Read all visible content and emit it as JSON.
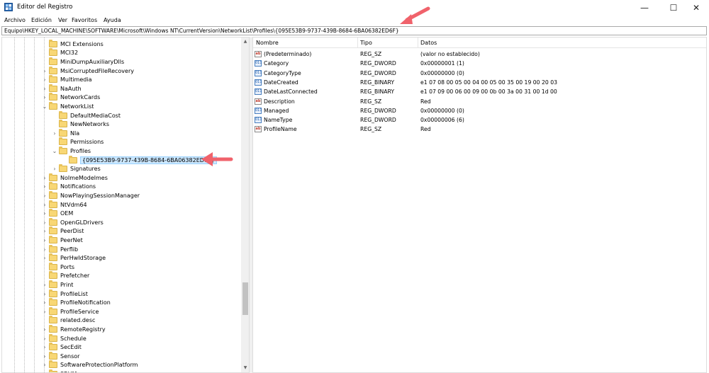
{
  "window": {
    "title": "Editor del Registro",
    "min_glyph": "—",
    "max_glyph": "☐",
    "close_glyph": "✕"
  },
  "menu": [
    "Archivo",
    "Edición",
    "Ver",
    "Favoritos",
    "Ayuda"
  ],
  "address": "Equipo\\HKEY_LOCAL_MACHINE\\SOFTWARE\\Microsoft\\Windows NT\\CurrentVersion\\NetworkList\\Profiles\\{095E53B9-9737-439B-8684-6BA06382ED6F}",
  "tree": [
    {
      "label": "MCI Extensions",
      "expandable": false
    },
    {
      "label": "MCI32",
      "expandable": false
    },
    {
      "label": "MiniDumpAuxiliaryDlls",
      "expandable": false
    },
    {
      "label": "MsiCorruptedFileRecovery",
      "expandable": true
    },
    {
      "label": "Multimedia",
      "expandable": true
    },
    {
      "label": "NaAuth",
      "expandable": true
    },
    {
      "label": "NetworkCards",
      "expandable": true
    },
    {
      "label": "NetworkList",
      "expandable": true,
      "expanded": true
    },
    {
      "label": "DefaultMediaCost",
      "expandable": false,
      "level": 1
    },
    {
      "label": "NewNetworks",
      "expandable": false,
      "level": 1
    },
    {
      "label": "Nla",
      "expandable": true,
      "level": 1
    },
    {
      "label": "Permissions",
      "expandable": false,
      "level": 1
    },
    {
      "label": "Profiles",
      "expandable": true,
      "expanded": true,
      "level": 1
    },
    {
      "label": "{095E53B9-9737-439B-8684-6BA06382ED6F}",
      "expandable": false,
      "level": 2,
      "selected": true
    },
    {
      "label": "Signatures",
      "expandable": true,
      "level": 1
    },
    {
      "label": "NoImeModelmes",
      "expandable": true
    },
    {
      "label": "Notifications",
      "expandable": true
    },
    {
      "label": "NowPlayingSessionManager",
      "expandable": true
    },
    {
      "label": "NtVdm64",
      "expandable": true
    },
    {
      "label": "OEM",
      "expandable": true
    },
    {
      "label": "OpenGLDrivers",
      "expandable": true
    },
    {
      "label": "PeerDist",
      "expandable": true
    },
    {
      "label": "PeerNet",
      "expandable": true
    },
    {
      "label": "Perflib",
      "expandable": true
    },
    {
      "label": "PerHwIdStorage",
      "expandable": true
    },
    {
      "label": "Ports",
      "expandable": false
    },
    {
      "label": "Prefetcher",
      "expandable": false
    },
    {
      "label": "Print",
      "expandable": true
    },
    {
      "label": "ProfileList",
      "expandable": true
    },
    {
      "label": "ProfileNotification",
      "expandable": true
    },
    {
      "label": "ProfileService",
      "expandable": true
    },
    {
      "label": "related.desc",
      "expandable": false
    },
    {
      "label": "RemoteRegistry",
      "expandable": true
    },
    {
      "label": "Schedule",
      "expandable": true
    },
    {
      "label": "SecEdit",
      "expandable": true
    },
    {
      "label": "Sensor",
      "expandable": true
    },
    {
      "label": "SoftwareProtectionPlatform",
      "expandable": true
    },
    {
      "label": "SRUM",
      "expandable": true
    }
  ],
  "columns": {
    "name": "Nombre",
    "type": "Tipo",
    "data": "Datos"
  },
  "values": [
    {
      "name": "(Predeterminado)",
      "type": "REG_SZ",
      "data": "(valor no establecido)",
      "icon": "ab"
    },
    {
      "name": "Category",
      "type": "REG_DWORD",
      "data": "0x00000001 (1)",
      "icon": "bin"
    },
    {
      "name": "CategoryType",
      "type": "REG_DWORD",
      "data": "0x00000000 (0)",
      "icon": "bin"
    },
    {
      "name": "DateCreated",
      "type": "REG_BINARY",
      "data": "e1 07 08 00 05 00 04 00 05 00 35 00 19 00 20 03",
      "icon": "bin"
    },
    {
      "name": "DateLastConnected",
      "type": "REG_BINARY",
      "data": "e1 07 09 00 06 00 09 00 0b 00 3a 00 31 00 1d 00",
      "icon": "bin"
    },
    {
      "name": "Description",
      "type": "REG_SZ",
      "data": "Red",
      "icon": "ab"
    },
    {
      "name": "Managed",
      "type": "REG_DWORD",
      "data": "0x00000000 (0)",
      "icon": "bin"
    },
    {
      "name": "NameType",
      "type": "REG_DWORD",
      "data": "0x00000006 (6)",
      "icon": "bin"
    },
    {
      "name": "ProfileName",
      "type": "REG_SZ",
      "data": "Red",
      "icon": "ab"
    }
  ],
  "icon_glyphs": {
    "ab": "ab",
    "bin": "011"
  },
  "colors": {
    "annotation_arrow": "#f0626b",
    "selection": "#cce8ff"
  }
}
